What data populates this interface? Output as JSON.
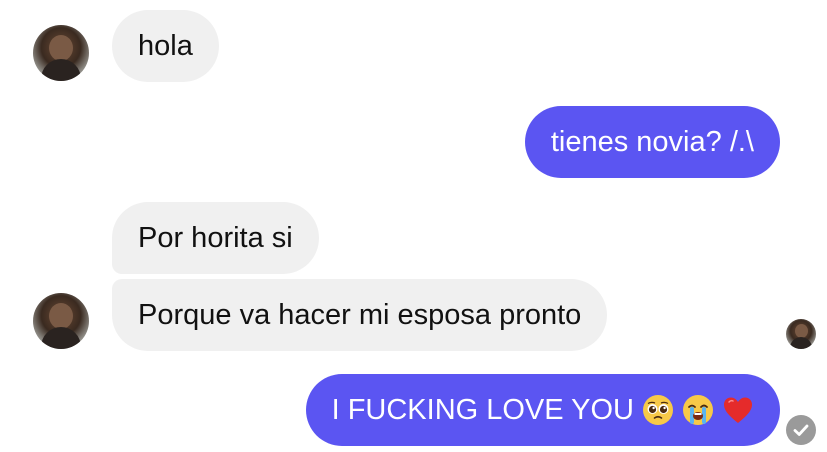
{
  "conversation": {
    "messages": [
      {
        "from": "them",
        "text": "hola"
      },
      {
        "from": "me",
        "text": "tienes novia? /.\\"
      },
      {
        "from": "them",
        "text": "Por horita si"
      },
      {
        "from": "them",
        "text": "Porque va hacer mi esposa pronto"
      },
      {
        "from": "me",
        "text": "I FUCKING LOVE YOU"
      }
    ],
    "last_message_emojis": [
      "pleading-face",
      "loudly-crying-face",
      "red-heart"
    ]
  },
  "colors": {
    "outgoing_bubble": "#5b55f2",
    "incoming_bubble": "#f0f0f0",
    "read_check": "#9a9a9a"
  },
  "icons": {
    "avatar": "contact-avatar",
    "read_receipt": "read-receipt-avatar",
    "delivered": "check-circle-icon"
  }
}
